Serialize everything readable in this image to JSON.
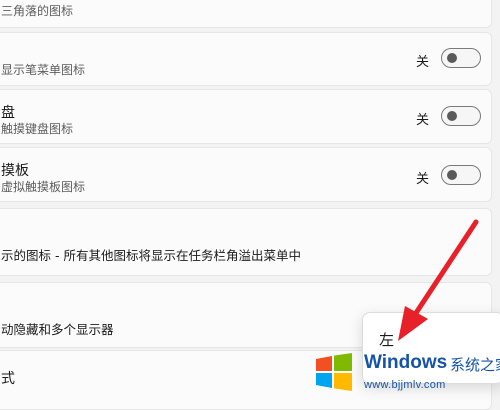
{
  "rows": [
    {
      "title": "",
      "subtitle": "三角落的图标"
    },
    {
      "title": "",
      "subtitle": "显示笔菜单图标",
      "state": "关"
    },
    {
      "title": "盘",
      "subtitle": "触摸键盘图标",
      "state": "关"
    },
    {
      "title": "摸板",
      "subtitle": "虚拟触摸板图标",
      "state": "关"
    }
  ],
  "overflow_section": {
    "text": "示的图标 - 所有其他图标将显示在任务栏角溢出菜单中"
  },
  "behaviors": {
    "multi_display_text": "动隐藏和多个显示器",
    "alignment_label": "式"
  },
  "alignment_dropdown": {
    "selected": "左"
  },
  "watermark": {
    "brand": "Windows",
    "brand_cn": "系统之家",
    "url": "www.bjjmlv.com"
  },
  "colors": {
    "arrow": "#e8202a",
    "brand": "#1554a8"
  }
}
